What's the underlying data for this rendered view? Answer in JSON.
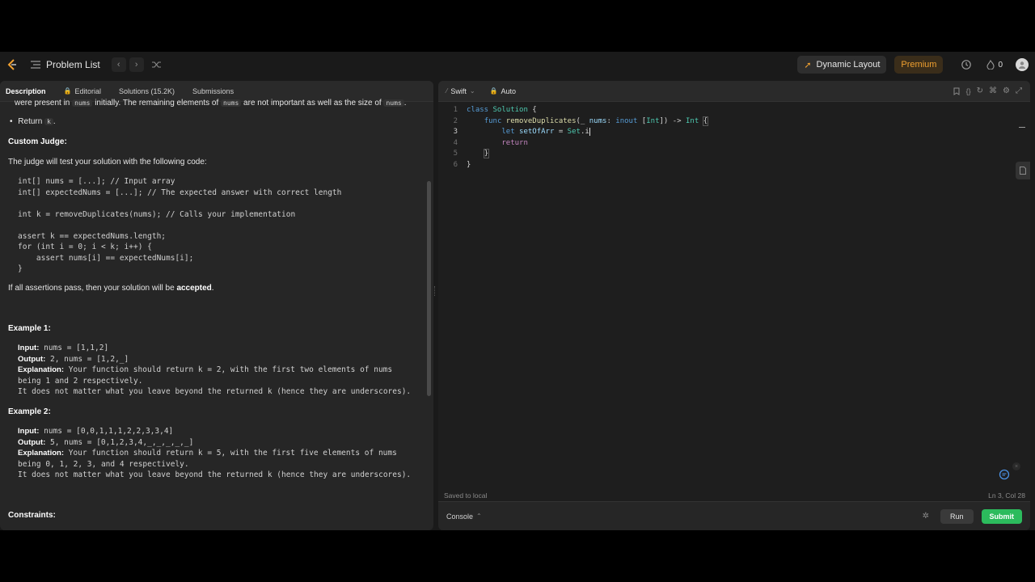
{
  "nav": {
    "problem_list": "Problem List",
    "dynamic_layout": "Dynamic Layout",
    "premium": "Premium",
    "streak_count": "0",
    "accent_orange": "#f0a030"
  },
  "left_tabs": [
    {
      "label": "Description"
    },
    {
      "label": "Editorial"
    },
    {
      "label": "Solutions (15.2K)"
    },
    {
      "label": "Submissions"
    }
  ],
  "description": {
    "cut_line_a": "were present in ",
    "cut_code_1": "nums",
    "cut_line_b": " initially. The remaining elements of ",
    "cut_code_2": "nums",
    "cut_line_c": " are not important as well as the size of ",
    "cut_code_3": "nums",
    "cut_line_d": ".",
    "bullet_return": "Return ",
    "bullet_code": "k",
    "bullet_end": ".",
    "custom_judge": "Custom Judge:",
    "judge_text": "The judge will test your solution with the following code:",
    "judge_code": [
      "int[] nums = [...]; // Input array",
      "int[] expectedNums = [...]; // The expected answer with correct length",
      "",
      "int k = removeDuplicates(nums); // Calls your implementation",
      "",
      "assert k == expectedNums.length;",
      "for (int i = 0; i < k; i++) {",
      "    assert nums[i] == expectedNums[i];",
      "}"
    ],
    "pass_text_a": "If all assertions pass, then your solution will be ",
    "pass_text_bold": "accepted",
    "pass_text_end": ".",
    "example1_title": "Example 1:",
    "example1": {
      "input_label": "Input:",
      "input": " nums = [1,1,2]",
      "output_label": "Output:",
      "output": " 2, nums = [1,2,_]",
      "explanation_label": "Explanation:",
      "explanation_1": " Your function should return k = 2, with the first two elements of nums",
      "explanation_2": "being 1 and 2 respectively.",
      "explanation_3": "It does not matter what you leave beyond the returned k (hence they are underscores)."
    },
    "example2_title": "Example 2:",
    "example2": {
      "input_label": "Input:",
      "input": " nums = [0,0,1,1,1,2,2,3,3,4]",
      "output_label": "Output:",
      "output": " 5, nums = [0,1,2,3,4,_,_,_,_,_]",
      "explanation_label": "Explanation:",
      "explanation_1": " Your function should return k = 5, with the first five elements of nums",
      "explanation_2": "being 0, 1, 2, 3, and 4 respectively.",
      "explanation_3": "It does not matter what you leave beyond the returned k (hence they are underscores)."
    },
    "constraints_title": "Constraints:"
  },
  "editor": {
    "language": "Swift",
    "mode": "Auto",
    "line_numbers": [
      "1",
      "2",
      "3",
      "4",
      "5",
      "6"
    ],
    "status_left": "Saved to local",
    "status_right": "Ln 3, Col 28",
    "console": "Console",
    "run": "Run",
    "submit": "Submit",
    "submit_color": "#2cbb5d"
  }
}
